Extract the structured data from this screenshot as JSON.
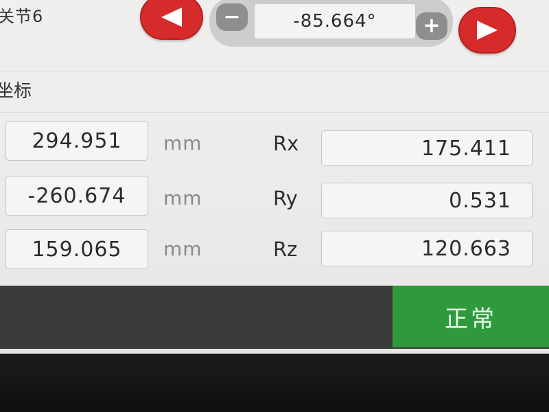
{
  "header": {
    "joint_label": "关节6",
    "angle_value": "-85.664°",
    "prev_icon": "arrow-left-icon",
    "next_icon": "arrow-right-icon",
    "minus_label": "−",
    "plus_label": "+"
  },
  "coords": {
    "title": "坐标",
    "rows": [
      {
        "pos_value": "294.951",
        "unit": "mm",
        "rot_label": "Rx",
        "rot_value": "175.411"
      },
      {
        "pos_value": "-260.674",
        "unit": "mm",
        "rot_label": "Ry",
        "rot_value": "0.531"
      },
      {
        "pos_value": "159.065",
        "unit": "mm",
        "rot_label": "Rz",
        "rot_value": "120.663"
      }
    ]
  },
  "status": {
    "text": "正常",
    "color": "#2f9a3c"
  },
  "colors": {
    "accent_red": "#d62b2b",
    "status_green": "#2f9a3c",
    "status_bar": "#3b3b3b"
  }
}
